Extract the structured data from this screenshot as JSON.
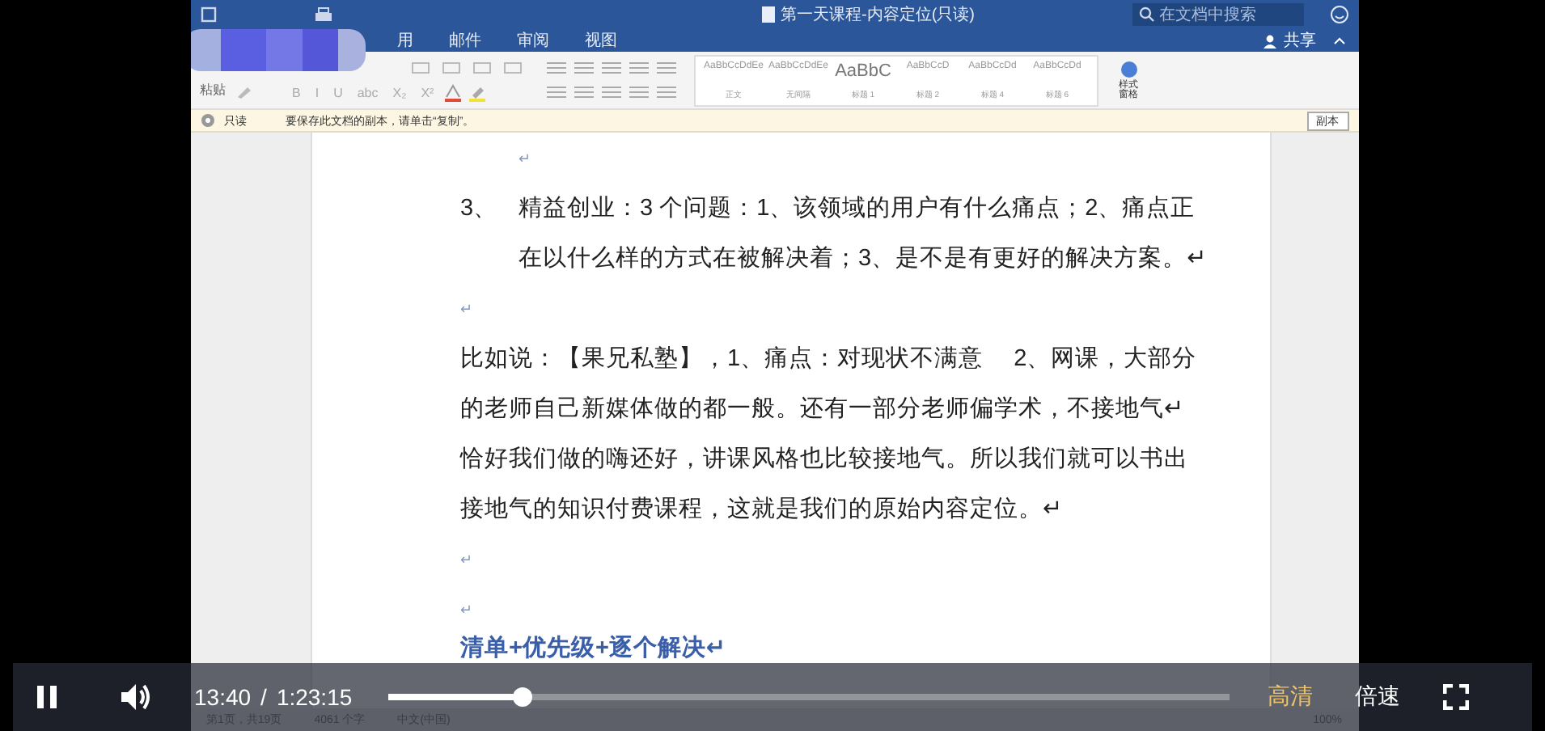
{
  "word": {
    "title": "第一天课程-内容定位(只读)",
    "search": {
      "placeholder": "在文档中搜索"
    },
    "share": "共享",
    "tabs": [
      {
        "label": "用",
        "selected": false
      },
      {
        "label": "邮件",
        "selected": false
      },
      {
        "label": "审阅",
        "selected": false
      },
      {
        "label": "视图",
        "selected": false
      }
    ],
    "paste": "粘贴",
    "font_buttons": [
      "B",
      "I",
      "U",
      "abc",
      "X₂",
      "X²"
    ],
    "styles": [
      {
        "sample": "AaBbCcDdEe",
        "name": "正文",
        "big": false
      },
      {
        "sample": "AaBbCcDdEe",
        "name": "无间隔",
        "big": false
      },
      {
        "sample": "AaBbC",
        "name": "标题 1",
        "big": true
      },
      {
        "sample": "AaBbCcD",
        "name": "标题 2",
        "big": false
      },
      {
        "sample": "AaBbCcDd",
        "name": "标题 4",
        "big": false
      },
      {
        "sample": "AaBbCcDd",
        "name": "标题 6",
        "big": false
      }
    ],
    "styles_pane": "样式窗格",
    "infobar": {
      "label": "只读",
      "message": "要保存此文档的副本，请单击“复制”。",
      "button": "副本"
    },
    "document": [
      {
        "kind": "mark",
        "text": "↵"
      },
      {
        "kind": "item",
        "number": "3、",
        "lines": [
          "精益创业：3 个问题：1、该领域的用户有什么痛点；2、痛点正",
          "在以什么样的方式在被解决着；3、是不是有更好的解决方案。↵"
        ]
      },
      {
        "kind": "mark",
        "text": "↵"
      },
      {
        "kind": "para",
        "lines": [
          "比如说：【果兄私塾】，1、痛点：对现状不满意　 2、网课，大部分",
          "的老师自己新媒体做的都一般。还有一部分老师偏学术，不接地气↵",
          "恰好我们做的嗨还好，讲课风格也比较接地气。所以我们就可以书出",
          "接地气的知识付费课程，这就是我们的原始内容定位。↵"
        ]
      },
      {
        "kind": "mark",
        "text": "↵"
      },
      {
        "kind": "mark",
        "text": "↵"
      },
      {
        "kind": "heading",
        "text": "清单+优先级+逐个解决↵"
      }
    ],
    "status": [
      "第1页，共19页",
      "4061 个字",
      "中文(中国)"
    ],
    "zoom": "100%"
  },
  "player": {
    "playing": true,
    "current": "13:40",
    "separator": "/",
    "duration": "1:23:15",
    "level": 0.16,
    "quality": "高清",
    "speed": "倍速"
  }
}
